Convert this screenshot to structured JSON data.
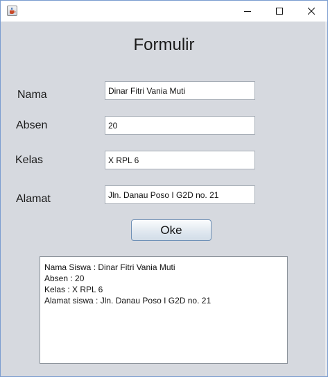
{
  "window": {
    "icons": {
      "app": "java-coffee-icon",
      "minimize": "minimize-icon",
      "maximize": "maximize-icon",
      "close": "close-icon"
    }
  },
  "form": {
    "title": "Formulir",
    "fields": [
      {
        "label": "Nama",
        "value": "Dinar Fitri Vania Muti"
      },
      {
        "label": "Absen",
        "value": "20"
      },
      {
        "label": "Kelas",
        "value": "X RPL 6"
      },
      {
        "label": "Alamat",
        "value": "Jln. Danau Poso I G2D no. 21"
      }
    ],
    "submit_label": "Oke"
  },
  "output": {
    "lines": [
      "Nama Siswa : Dinar Fitri Vania Muti",
      "Absen : 20",
      "Kelas : X RPL 6",
      "Alamat siswa : Jln. Danau Poso I G2D no. 21"
    ]
  },
  "colors": {
    "background": "#d6d9df",
    "titlebar": "#ffffff",
    "field_border": "#a5acb5",
    "button_border": "#6d8fb5"
  }
}
